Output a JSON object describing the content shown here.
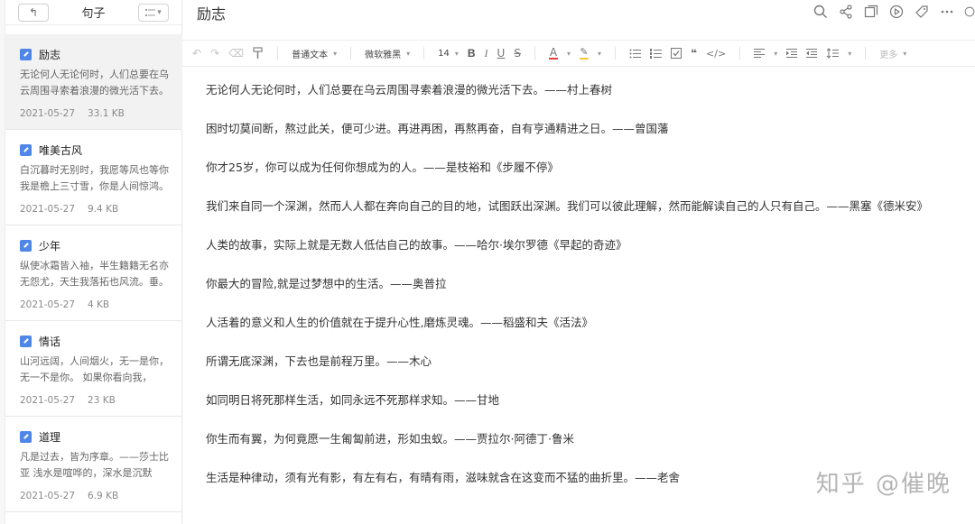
{
  "sidebar": {
    "title": "句子",
    "back_icon": "↰",
    "notes": [
      {
        "title": "励志",
        "preview": "无论何人无论何时，人们总要在乌云周围寻索着浪漫的微光活下去。",
        "date": "2021-05-27",
        "size": "33.1 KB"
      },
      {
        "title": "唯美古风",
        "preview": "白沉暮时无别时，我愿等风也等你 我是檐上三寸雪，你是人间惊鸿。",
        "date": "2021-05-27",
        "size": "9.4 KB"
      },
      {
        "title": "少年",
        "preview": "纵使冰霜皆入袖，半生籍籍无名亦无怨尤，天生我落拓也风流。垂。",
        "date": "2021-05-27",
        "size": "4 KB"
      },
      {
        "title": "情话",
        "preview": "山河远阔，人间烟火，无一是你，无一不是你。 如果你看向我，我。",
        "date": "2021-05-27",
        "size": "23 KB"
      },
      {
        "title": "道理",
        "preview": "凡是过去，皆为序章。——莎士比亚 浅水是喧哗的，深水是沉默的。",
        "date": "2021-05-27",
        "size": "6.9 KB"
      }
    ]
  },
  "document": {
    "title": "励志",
    "paragraphs": [
      "无论何人无论何时，人们总要在乌云周围寻索着浪漫的微光活下去。——村上春树",
      "困时切莫间断，熬过此关，便可少进。再进再困，再熬再奋，自有亨通精进之日。——曾国藩",
      "你才25岁，你可以成为任何你想成为的人。——是枝裕和《步履不停》",
      "我们来自同一个深渊，然而人人都在奔向自己的目的地，试图跃出深渊。我们可以彼此理解，然而能解读自己的人只有自己。——黑塞《德米安》",
      "人类的故事，实际上就是无数人低估自己的故事。——哈尔·埃尔罗德《早起的奇迹》",
      "你最大的冒险,就是过梦想中的生活。——奥普拉",
      "人活着的意义和人生的价值就在于提升心性,磨炼灵魂。——稻盛和夫《活法》",
      "所谓无底深渊，下去也是前程万里。——木心",
      "如同明日将死那样生活，如同永远不死那样求知。——甘地",
      "你生而有翼，为何竟愿一生匍匐前进，形如虫蚁。——贾拉尔·阿德丁·鲁米",
      "生活是种律动，须有光有影，有左有右，有晴有雨，滋味就含在这变而不猛的曲折里。——老舍"
    ]
  },
  "toolbar": {
    "style_select": "普通文本",
    "font_select": "微软雅黑",
    "size_select": "14",
    "more_label": "更多"
  },
  "watermark": "知乎 @催晚"
}
